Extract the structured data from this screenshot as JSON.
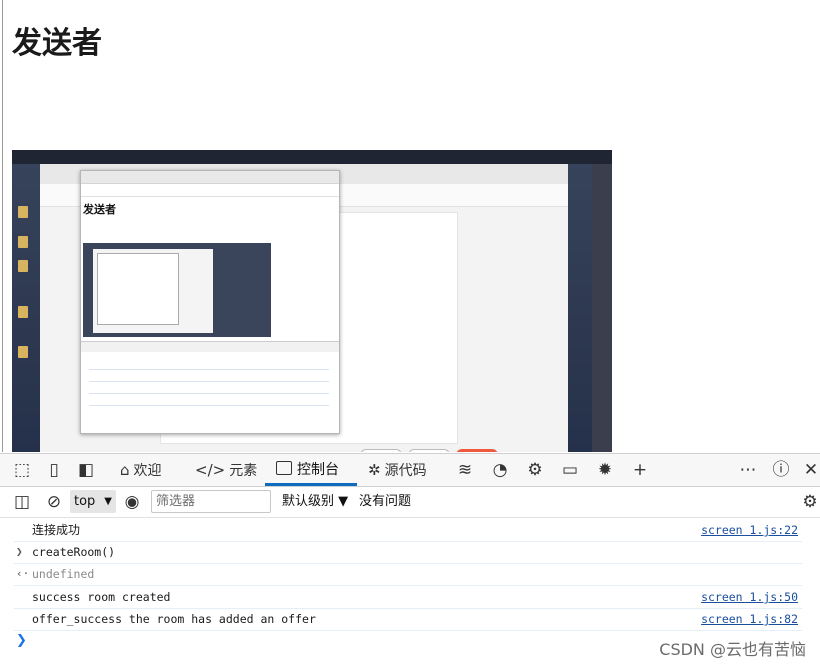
{
  "page": {
    "title": "发送者"
  },
  "shared_screen": {
    "inner_title": "发送者"
  },
  "devtools": {
    "tabs": [
      {
        "label": "欢迎",
        "icon": "home-icon"
      },
      {
        "label": "元素",
        "icon": "code-icon"
      },
      {
        "label": "控制台",
        "icon": "console-icon",
        "active": true
      },
      {
        "label": "源代码",
        "icon": "bug-icon"
      }
    ],
    "toolbar": {
      "context": "top",
      "filter_placeholder": "筛选器",
      "level": "默认级别",
      "issues": "没有问题"
    },
    "console": [
      {
        "type": "log",
        "message": "连接成功",
        "source": "screen 1.js:22"
      },
      {
        "type": "input",
        "message": "createRoom()",
        "source": ""
      },
      {
        "type": "result",
        "message": "undefined",
        "source": ""
      },
      {
        "type": "log",
        "message": "success room created",
        "source": "screen 1.js:50"
      },
      {
        "type": "log",
        "message": "offer_success the room has added an offer",
        "source": "screen 1.js:82"
      }
    ]
  },
  "watermark": "CSDN @云也有苦恼",
  "colors": {
    "accent": "#0f6cbd",
    "link": "#1a4fa0"
  }
}
